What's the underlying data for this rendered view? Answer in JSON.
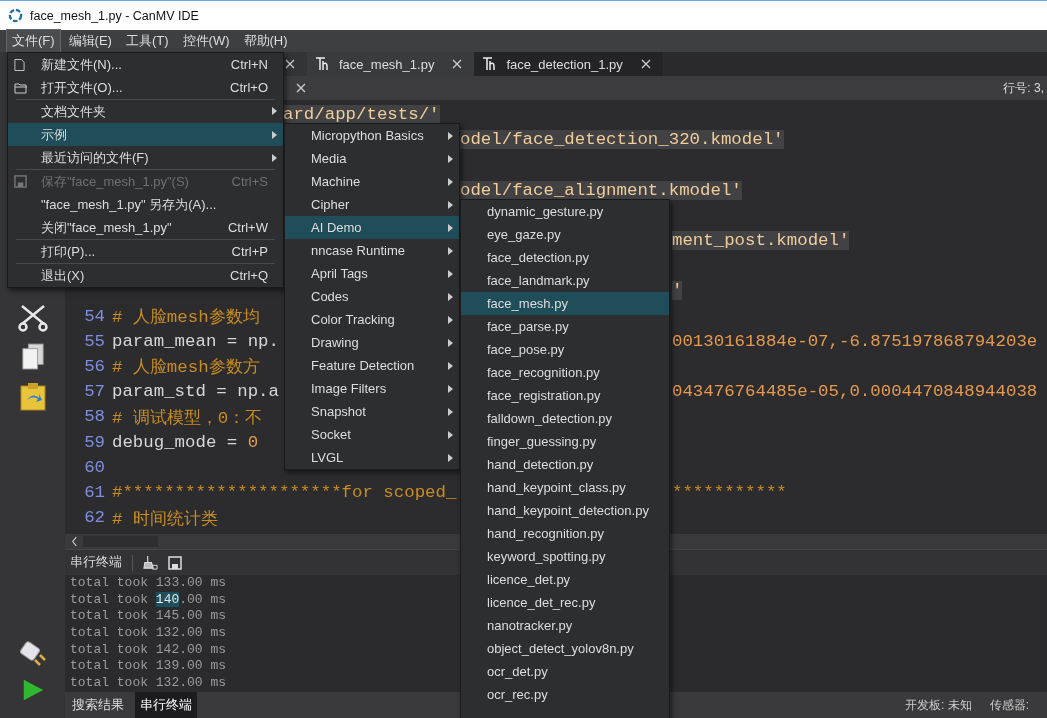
{
  "window": {
    "title": "face_mesh_1.py - CanMV IDE"
  },
  "menubar": [
    {
      "label": "文件(F)",
      "selected": true
    },
    {
      "label": "编辑(E)",
      "selected": false
    },
    {
      "label": "工具(T)",
      "selected": false
    },
    {
      "label": "控件(W)",
      "selected": false
    },
    {
      "label": "帮助(H)",
      "selected": false
    }
  ],
  "tabs": [
    {
      "label": "face_mesh_1.py",
      "selected": true
    },
    {
      "label": "face_detection_1.py",
      "selected": false
    }
  ],
  "editor_bar": {
    "position": "行号: 3,"
  },
  "code_lines": [
    {
      "right": [
        {
          "text": "ard/app/tests/'",
          "kind": "string"
        }
      ]
    },
    {
      "right": [
        {
          "text": "odel/face_detection_320.kmodel'",
          "kind": "string"
        }
      ]
    },
    {
      "right": [
        {
          "text": "odel/face_alignment.kmodel'",
          "kind": "string"
        }
      ]
    },
    {
      "right": [
        {
          "text": "ment_post.kmodel'",
          "kind": "string"
        }
      ]
    },
    {
      "right": [
        {
          "text": "'",
          "kind": "string"
        }
      ]
    },
    {
      "number": "54",
      "left": [
        {
          "text": "# 人脸mesh参数均",
          "kind": "comment"
        }
      ]
    },
    {
      "number": "55",
      "left": [
        {
          "text": "param_mean = np.",
          "kind": "plain"
        }
      ],
      "right": [
        {
          "text": "00130161884e-07,-6.875197868794203e",
          "kind": "number"
        }
      ]
    },
    {
      "number": "56",
      "left": [
        {
          "text": "# 人脸mesh参数方",
          "kind": "comment"
        }
      ]
    },
    {
      "number": "57",
      "left": [
        {
          "text": "param_std = np.a",
          "kind": "plain"
        }
      ],
      "right": [
        {
          "text": "043476764485e-05,0.0004470848944038",
          "kind": "number"
        }
      ]
    },
    {
      "number": "58",
      "left": [
        {
          "text": "# 调试模型，0：不",
          "kind": "comment"
        }
      ]
    },
    {
      "number": "59",
      "left": [
        {
          "text": "debug_mode = ",
          "kind": "plain"
        },
        {
          "text": "0",
          "kind": "number"
        }
      ]
    },
    {
      "number": "60"
    },
    {
      "number": "61",
      "left": [
        {
          "text": "#*********************for scoped_",
          "kind": "comment"
        }
      ],
      "right": [
        {
          "text": "***********",
          "kind": "comment"
        }
      ]
    },
    {
      "number": "62",
      "left": [
        {
          "text": "# 时间统计类",
          "kind": "comment"
        }
      ]
    }
  ],
  "terminal": {
    "title": "串行终端",
    "lines": [
      {
        "segments": [
          {
            "text": "total took 133.00 ms",
            "selected": false
          }
        ]
      },
      {
        "segments": [
          {
            "text": "total took ",
            "selected": false
          },
          {
            "text": "140",
            "selected": true
          },
          {
            "text": ".00 ms",
            "selected": false
          }
        ]
      },
      {
        "segments": [
          {
            "text": "total took 145.00 ms",
            "selected": false
          }
        ]
      },
      {
        "segments": [
          {
            "text": "total took 132.00 ms",
            "selected": false
          }
        ]
      },
      {
        "segments": [
          {
            "text": "total took 142.00 ms",
            "selected": false
          }
        ]
      },
      {
        "segments": [
          {
            "text": "total took 139.00 ms",
            "selected": false
          }
        ]
      },
      {
        "segments": [
          {
            "text": "total took 132.00 ms",
            "selected": false
          }
        ]
      }
    ]
  },
  "bottom_tabs": [
    {
      "label": "搜索结果",
      "selected": false
    },
    {
      "label": "串行终端",
      "selected": true
    }
  ],
  "status_bar": {
    "board": "开发板: 未知",
    "sensor": "传感器:"
  },
  "file_menu": [
    {
      "label": "新建文件(N)...",
      "shortcut": "Ctrl+N",
      "submenu": false,
      "selected": false,
      "disabled": false,
      "separator_before": false
    },
    {
      "label": "打开文件(O)...",
      "shortcut": "Ctrl+O",
      "submenu": false,
      "selected": false,
      "disabled": false,
      "separator_before": false
    },
    {
      "label": "文档文件夹",
      "submenu": true,
      "selected": false,
      "disabled": false,
      "separator_before": true
    },
    {
      "label": "示例",
      "submenu": true,
      "selected": true,
      "disabled": false,
      "separator_before": false
    },
    {
      "label": "最近访问的文件(F)",
      "submenu": true,
      "selected": false,
      "disabled": false,
      "separator_before": false
    },
    {
      "label": "保存\"face_mesh_1.py\"(S)",
      "shortcut": "Ctrl+S",
      "submenu": false,
      "selected": false,
      "disabled": true,
      "separator_before": true
    },
    {
      "label": "\"face_mesh_1.py\" 另存为(A)...",
      "submenu": false,
      "selected": false,
      "disabled": false,
      "separator_before": false
    },
    {
      "label": "关闭\"face_mesh_1.py\"",
      "shortcut": "Ctrl+W",
      "submenu": false,
      "selected": false,
      "disabled": false,
      "separator_before": false
    },
    {
      "label": "打印(P)...",
      "shortcut": "Ctrl+P",
      "submenu": false,
      "selected": false,
      "disabled": false,
      "separator_before": true
    },
    {
      "label": "退出(X)",
      "shortcut": "Ctrl+Q",
      "submenu": false,
      "selected": false,
      "disabled": false,
      "separator_before": true
    }
  ],
  "examples_menu": [
    {
      "label": "Micropython Basics",
      "selected": false
    },
    {
      "label": "Media",
      "selected": false
    },
    {
      "label": "Machine",
      "selected": false
    },
    {
      "label": "Cipher",
      "selected": false
    },
    {
      "label": "AI Demo",
      "selected": true
    },
    {
      "label": "nncase Runtime",
      "selected": false
    },
    {
      "label": "April Tags",
      "selected": false
    },
    {
      "label": "Codes",
      "selected": false
    },
    {
      "label": "Color Tracking",
      "selected": false
    },
    {
      "label": "Drawing",
      "selected": false
    },
    {
      "label": "Feature Detection",
      "selected": false
    },
    {
      "label": "Image Filters",
      "selected": false
    },
    {
      "label": "Snapshot",
      "selected": false
    },
    {
      "label": "Socket",
      "selected": false
    },
    {
      "label": "LVGL",
      "selected": false
    }
  ],
  "ai_demo_menu": [
    {
      "label": "dynamic_gesture.py",
      "selected": false
    },
    {
      "label": "eye_gaze.py",
      "selected": false
    },
    {
      "label": "face_detection.py",
      "selected": false
    },
    {
      "label": "face_landmark.py",
      "selected": false
    },
    {
      "label": "face_mesh.py",
      "selected": true
    },
    {
      "label": "face_parse.py",
      "selected": false
    },
    {
      "label": "face_pose.py",
      "selected": false
    },
    {
      "label": "face_recognition.py",
      "selected": false
    },
    {
      "label": "face_registration.py",
      "selected": false
    },
    {
      "label": "falldown_detection.py",
      "selected": false
    },
    {
      "label": "finger_guessing.py",
      "selected": false
    },
    {
      "label": "hand_detection.py",
      "selected": false
    },
    {
      "label": "hand_keypoint_class.py",
      "selected": false
    },
    {
      "label": "hand_keypoint_detection.py",
      "selected": false
    },
    {
      "label": "hand_recognition.py",
      "selected": false
    },
    {
      "label": "keyword_spotting.py",
      "selected": false
    },
    {
      "label": "licence_det.py",
      "selected": false
    },
    {
      "label": "licence_det_rec.py",
      "selected": false
    },
    {
      "label": "nanotracker.py",
      "selected": false
    },
    {
      "label": "object_detect_yolov8n.py",
      "selected": false
    },
    {
      "label": "ocr_det.py",
      "selected": false
    },
    {
      "label": "ocr_rec.py",
      "selected": false
    }
  ]
}
